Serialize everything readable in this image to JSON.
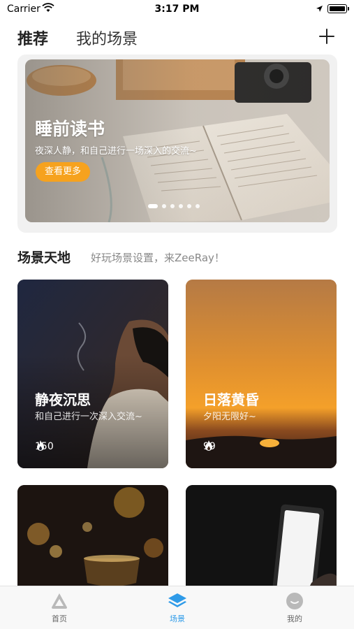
{
  "status_bar": {
    "carrier": "Carrier",
    "time": "3:17 PM"
  },
  "top_nav": {
    "tabs": [
      {
        "label": "推荐",
        "active": true
      },
      {
        "label": "我的场景",
        "active": false
      }
    ],
    "add_icon": "plus-icon"
  },
  "banner": {
    "title": "睡前读书",
    "subtitle": "夜深人静，和自己进行一场深入的交流~",
    "more_label": "查看更多",
    "dots_total": 6,
    "dots_active": 1
  },
  "section": {
    "title": "场景天地",
    "subtitle": "好玩场景设置，来ZeeRay！"
  },
  "scenes": [
    {
      "title": "静夜沉思",
      "desc": "和自己进行一次深入交流~",
      "hot": "150"
    },
    {
      "title": "日落黄昏",
      "desc": "夕阳无限好~",
      "hot": "99"
    },
    {
      "title": "",
      "desc": "",
      "hot": ""
    },
    {
      "title": "",
      "desc": "",
      "hot": ""
    }
  ],
  "tabbar": {
    "items": [
      {
        "label": "首页",
        "icon": "home-icon",
        "active": false
      },
      {
        "label": "场景",
        "icon": "layers-icon",
        "active": true
      },
      {
        "label": "我的",
        "icon": "profile-icon",
        "active": false
      }
    ]
  },
  "colors": {
    "accent": "#2f9be8",
    "button": "#f6a21e",
    "text": "#222222"
  }
}
